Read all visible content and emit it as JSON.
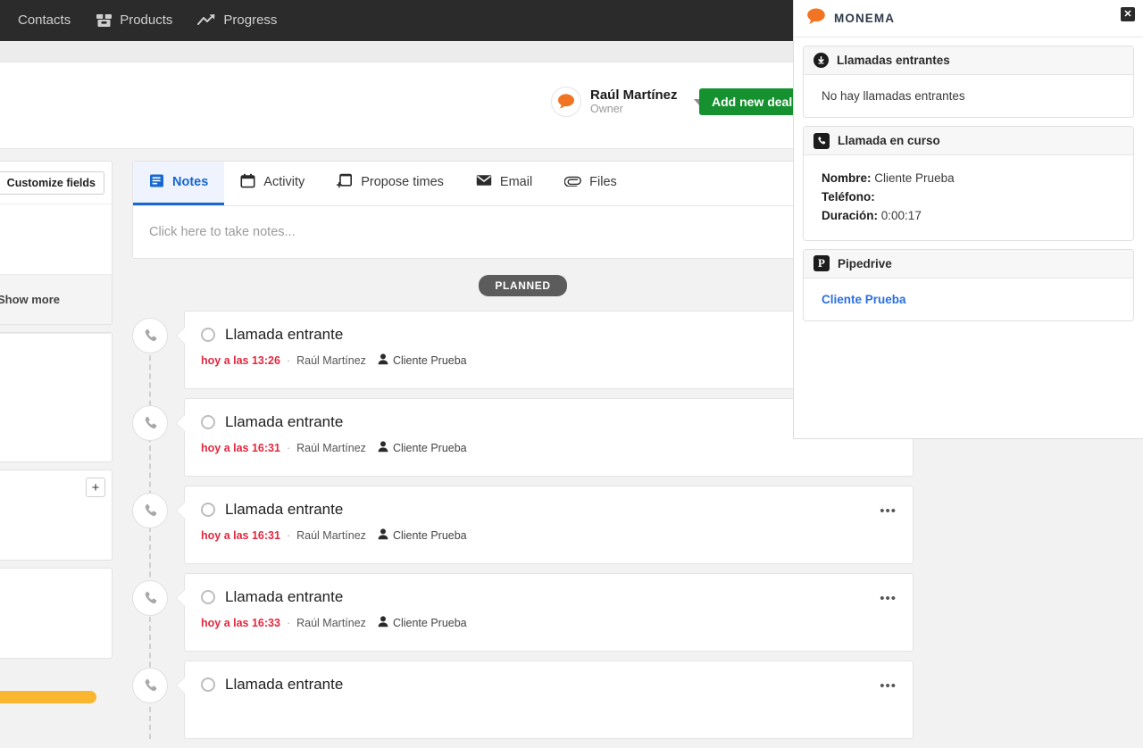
{
  "topnav": {
    "items": [
      {
        "label": "Contacts",
        "icon": ""
      },
      {
        "label": "Products",
        "icon": "box-icon"
      },
      {
        "label": "Progress",
        "icon": "trend-up-icon"
      }
    ]
  },
  "header": {
    "owner_name": "Raúl Martínez",
    "owner_role": "Owner",
    "add_deal_label": "Add new deal"
  },
  "sidebar": {
    "customize_label": "Customize fields",
    "show_more_label": "Show more",
    "add_label": "+"
  },
  "main": {
    "tabs": [
      {
        "label": "Notes",
        "icon": "note-icon",
        "active": true
      },
      {
        "label": "Activity",
        "icon": "calendar-icon",
        "active": false
      },
      {
        "label": "Propose times",
        "icon": "calendar-plus-icon",
        "active": false
      },
      {
        "label": "Email",
        "icon": "envelope-icon",
        "active": false
      },
      {
        "label": "Files",
        "icon": "paperclip-icon",
        "active": false
      }
    ],
    "note_placeholder": "Click here to take notes...",
    "section_badge": "PLANNED",
    "activities": [
      {
        "title": "Llamada entrante",
        "time": "hoy a las 13:26",
        "separator": "·",
        "owner": "Raúl Martínez",
        "person": "Cliente Prueba",
        "menu": "•••"
      },
      {
        "title": "Llamada entrante",
        "time": "hoy a las 16:31",
        "separator": "·",
        "owner": "Raúl Martínez",
        "person": "Cliente Prueba",
        "menu": "•••"
      },
      {
        "title": "Llamada entrante",
        "time": "hoy a las 16:31",
        "separator": "·",
        "owner": "Raúl Martínez",
        "person": "Cliente Prueba",
        "menu": "•••"
      },
      {
        "title": "Llamada entrante",
        "time": "hoy a las 16:33",
        "separator": "·",
        "owner": "Raúl Martínez",
        "person": "Cliente Prueba",
        "menu": "•••"
      },
      {
        "title": "Llamada entrante",
        "time": "",
        "separator": "",
        "owner": "",
        "person": "",
        "menu": "•••"
      }
    ]
  },
  "monema": {
    "title": "MONEMA",
    "close_label": "✕",
    "incoming": {
      "header": "Llamadas entrantes",
      "empty_text": "No hay llamadas entrantes"
    },
    "current_call": {
      "header": "Llamada en curso",
      "name_label": "Nombre:",
      "name_value": "Cliente Prueba",
      "phone_label": "Teléfono:",
      "phone_value": "",
      "duration_label": "Duración:",
      "duration_value": "0:00:17"
    },
    "pipedrive": {
      "header": "Pipedrive",
      "link": "Cliente Prueba"
    }
  },
  "colors": {
    "nav_bg": "#2b2b2b",
    "accent_green": "#15912f",
    "accent_blue": "#1767d1",
    "time_red": "#e4273e",
    "badge_gray": "#5c5c5c",
    "brand_orange": "#f07422",
    "link_blue": "#2b6fdd",
    "yellow_bar": "#fbb630"
  }
}
